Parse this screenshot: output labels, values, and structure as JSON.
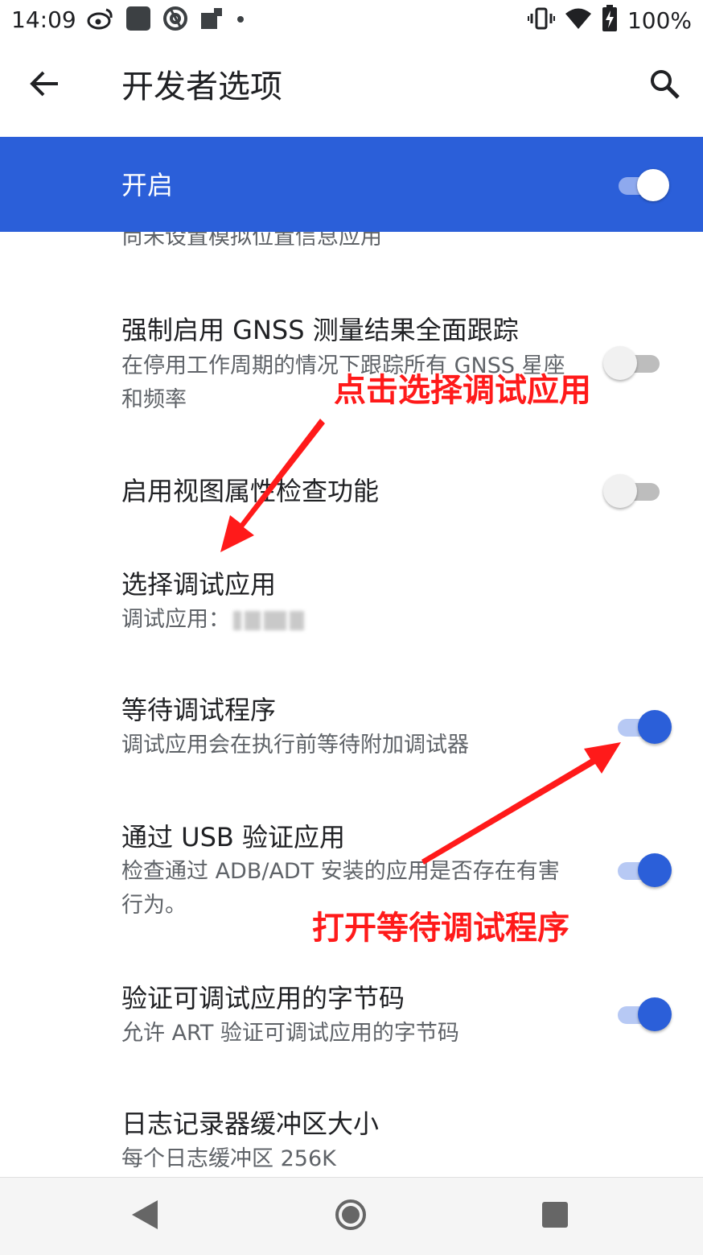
{
  "status_bar": {
    "time": "14:09",
    "battery_text": "100%",
    "left_icons": [
      "weibo-icon",
      "app-icon",
      "at-icon",
      "notification-icon",
      "dot-icon"
    ],
    "right_icons": [
      "vibrate-icon",
      "wifi-icon",
      "battery-charging-icon"
    ]
  },
  "app_bar": {
    "title": "开发者选项",
    "back_icon": "arrow-back-icon",
    "search_icon": "search-icon"
  },
  "master_switch": {
    "label": "开启",
    "on": true
  },
  "settings": {
    "partial_top": {
      "summary": "尚未设置模拟位置信息应用"
    },
    "gnss": {
      "title": "强制启用 GNSS 测量结果全面跟踪",
      "summary": "在停用工作周期的情况下跟踪所有 GNSS 星座和频率",
      "on": false
    },
    "view_attr": {
      "title": "启用视图属性检查功能",
      "on": false
    },
    "debug_app": {
      "title": "选择调试应用",
      "summary": "调试应用："
    },
    "wait_debugger": {
      "title": "等待调试程序",
      "summary": "调试应用会在执行前等待附加调试器",
      "on": true
    },
    "verify_usb": {
      "title": "通过 USB 验证应用",
      "summary": "检查通过 ADB/ADT 安装的应用是否存在有害行为。",
      "on": true
    },
    "verify_bytecode": {
      "title": "验证可调试应用的字节码",
      "summary": "允许 ART 验证可调试应用的字节码",
      "on": true
    },
    "logger_buffer": {
      "title": "日志记录器缓冲区大小",
      "summary": "每个日志缓冲区 256K"
    }
  },
  "annotations": {
    "select_debug_app": "点击选择调试应用",
    "open_wait_debugger": "打开等待调试程序"
  },
  "colors": {
    "accent": "#2b5fd9",
    "annotation": "#ff1a1a"
  },
  "nav_bar": {
    "icons": [
      "back-triangle-icon",
      "home-circle-icon",
      "recents-square-icon"
    ]
  }
}
